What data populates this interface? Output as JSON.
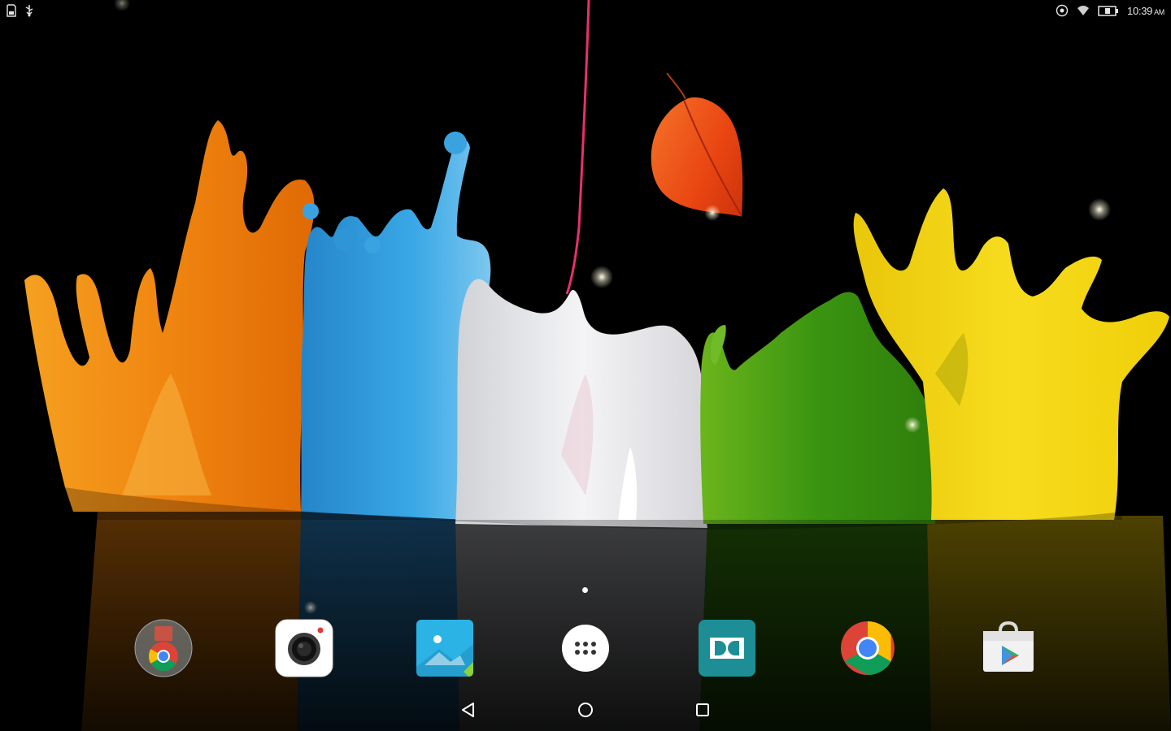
{
  "status_bar": {
    "time": "10:39",
    "ampm": "AM",
    "left_icons": [
      "sd-card-icon",
      "usb-icon"
    ],
    "right_icons": [
      "sync-icon",
      "wifi-icon",
      "battery-icon"
    ]
  },
  "home": {
    "page_count": 1,
    "current_page": 1
  },
  "dock": {
    "items": [
      {
        "name": "google-folder",
        "icon": "chrome-folder-icon"
      },
      {
        "name": "camera",
        "icon": "camera-icon"
      },
      {
        "name": "gallery",
        "icon": "gallery-icon"
      },
      {
        "name": "app-drawer",
        "icon": "apps-grid-icon"
      },
      {
        "name": "dolby",
        "icon": "dolby-icon"
      },
      {
        "name": "chrome",
        "icon": "chrome-icon"
      },
      {
        "name": "play-store",
        "icon": "play-store-icon"
      }
    ]
  },
  "nav_bar": {
    "buttons": [
      "back-icon",
      "home-icon",
      "recents-icon"
    ]
  },
  "colors": {
    "orange": "#f28a12",
    "blue": "#2f9fe0",
    "white_paint": "#e8e8ea",
    "green": "#3d9a12",
    "yellow": "#f3d10a",
    "leaf": "#f0521a",
    "dolby_teal": "#1e8e96",
    "gallery_blue": "#2bb3e6"
  }
}
